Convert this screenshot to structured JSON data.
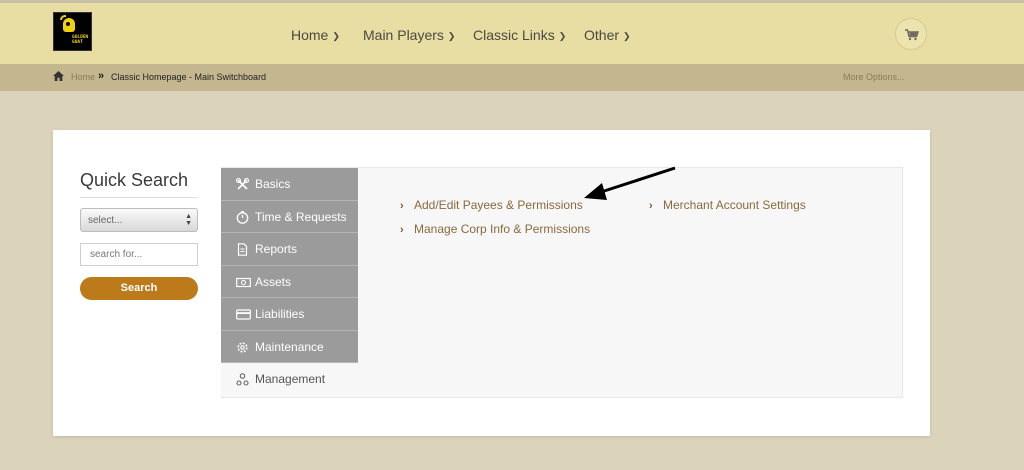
{
  "logo": {
    "line1": "GOLDEN",
    "line2": "GOAT"
  },
  "nav": [
    {
      "label": "Home"
    },
    {
      "label": "Main Players"
    },
    {
      "label": "Classic Links"
    },
    {
      "label": "Other"
    }
  ],
  "breadcrumb": {
    "home": "Home",
    "separator": "»",
    "current": "Classic Homepage - Main Switchboard",
    "more": "More Options..."
  },
  "quick_search": {
    "title": "Quick Search",
    "select_value": "select...",
    "input_placeholder": "search for...",
    "button_label": "Search"
  },
  "tabs": [
    {
      "label": "Basics",
      "icon": "tools-icon"
    },
    {
      "label": "Time & Requests",
      "icon": "stopwatch-icon"
    },
    {
      "label": "Reports",
      "icon": "document-icon"
    },
    {
      "label": "Assets",
      "icon": "money-icon"
    },
    {
      "label": "Liabilities",
      "icon": "credit-card-icon"
    },
    {
      "label": "Maintenance",
      "icon": "gear-icon"
    },
    {
      "label": "Management",
      "icon": "users-icon"
    }
  ],
  "links": [
    {
      "label": "Add/Edit Payees & Permissions",
      "bullet": "›"
    },
    {
      "label": "Manage Corp Info & Permissions",
      "bullet": "›"
    },
    {
      "label": "Merchant Account Settings",
      "bullet": "›"
    }
  ],
  "colors": {
    "header_bg": "#e8dda3",
    "breadcrumb_bg": "#c4b68e",
    "page_bg": "#dcd3bb",
    "accent_button": "#bd7a1a",
    "tab_bg": "#9b9b9b",
    "link_color": "#8a6a3e"
  }
}
